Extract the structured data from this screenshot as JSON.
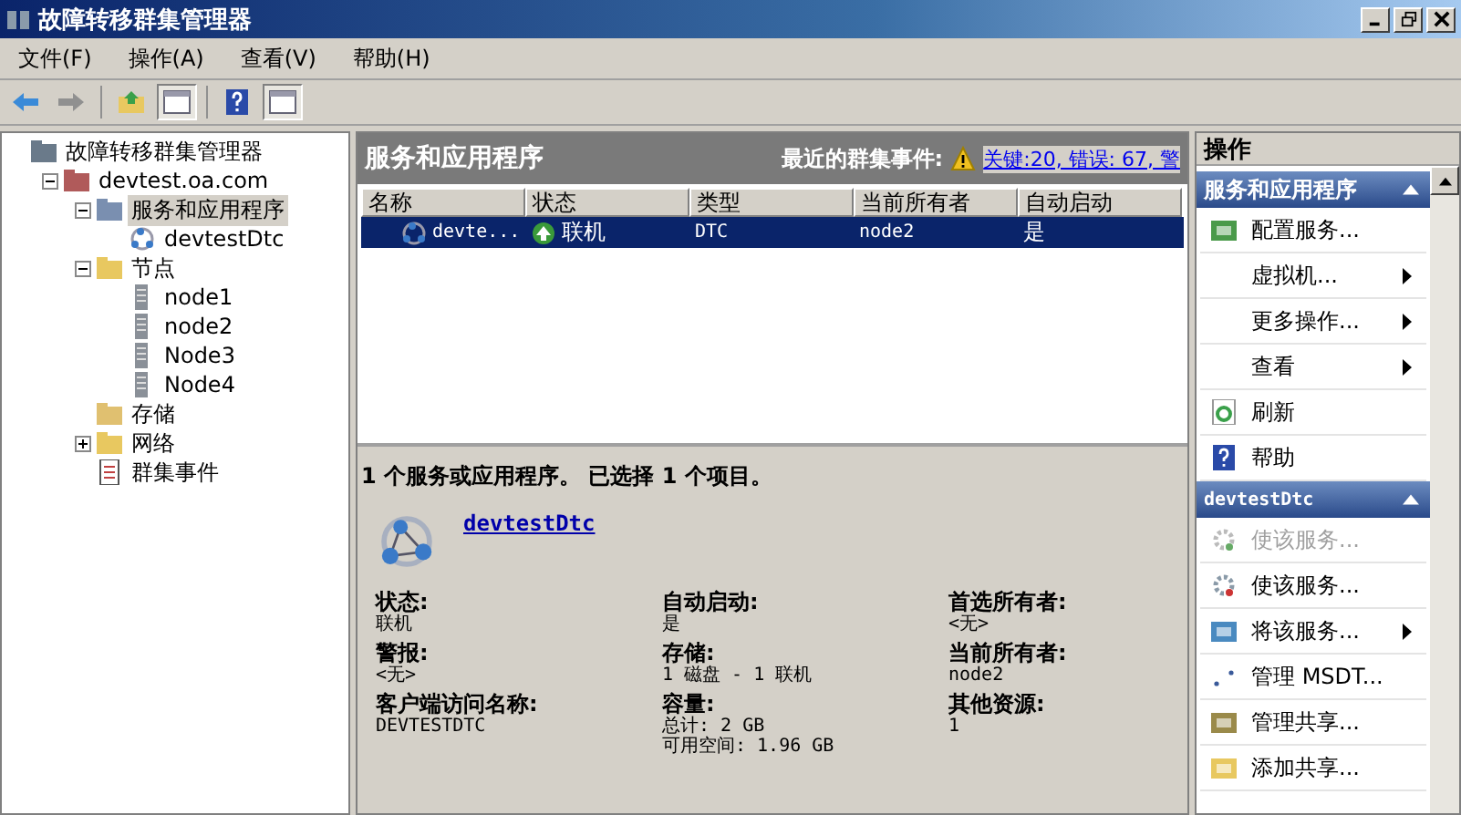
{
  "window": {
    "title": "故障转移群集管理器"
  },
  "menu": [
    "文件(F)",
    "操作(A)",
    "查看(V)",
    "帮助(H)"
  ],
  "tree": [
    {
      "label": "故障转移群集管理器",
      "kind": "manager",
      "selected": false,
      "children": [
        {
          "label": "devtest.oa.com",
          "kind": "cluster",
          "selected": false,
          "expanded": true,
          "children": [
            {
              "label": "服务和应用程序",
              "kind": "services",
              "selected": true,
              "expanded": true,
              "children": [
                {
                  "label": "devtestDtc",
                  "kind": "app",
                  "selected": false
                }
              ]
            },
            {
              "label": "节点",
              "kind": "folder",
              "selected": false,
              "expanded": true,
              "children": [
                {
                  "label": "node1",
                  "kind": "server",
                  "selected": false
                },
                {
                  "label": "node2",
                  "kind": "server",
                  "selected": false
                },
                {
                  "label": "Node3",
                  "kind": "server",
                  "selected": false
                },
                {
                  "label": "Node4",
                  "kind": "server",
                  "selected": false
                }
              ]
            },
            {
              "label": "存储",
              "kind": "storage",
              "selected": false
            },
            {
              "label": "网络",
              "kind": "folder",
              "selected": false,
              "expanded": false
            },
            {
              "label": "群集事件",
              "kind": "events",
              "selected": false
            }
          ]
        }
      ]
    }
  ],
  "center": {
    "title": "服务和应用程序",
    "events_label": "最近的群集事件:",
    "events_link": "关键:20, 错误: 67, 警"
  },
  "table": {
    "columns": [
      "名称",
      "状态",
      "类型",
      "当前所有者",
      "自动启动"
    ],
    "rows": [
      {
        "cells": [
          "devte...",
          "联机",
          "DTC",
          "node2",
          "是"
        ],
        "selected": true
      }
    ]
  },
  "summary": "1 个服务或应用程序。 已选择 1 个项目。",
  "detail": {
    "name": "devtestDtc",
    "fields": [
      {
        "label": "状态:",
        "values": [
          "联机"
        ]
      },
      {
        "label": "自动启动:",
        "values": [
          "是"
        ]
      },
      {
        "label": "首选所有者:",
        "values": [
          "<无>"
        ]
      },
      {
        "label": "警报:",
        "values": [
          "<无>"
        ]
      },
      {
        "label": "存储:",
        "values": [
          "1 磁盘 - 1 联机"
        ]
      },
      {
        "label": "当前所有者:",
        "values": [
          "node2"
        ]
      },
      {
        "label": "客户端访问名称:",
        "values": [
          "DEVTESTDTC"
        ]
      },
      {
        "label": "容量:",
        "values": [
          "总计: 2 GB",
          "可用空间: 1.96 GB"
        ]
      },
      {
        "label": "其他资源:",
        "values": [
          "1"
        ]
      }
    ]
  },
  "actions": {
    "title": "操作",
    "sections": [
      {
        "title": "服务和应用程序",
        "items": [
          {
            "label": "配置服务...",
            "kind": "configure",
            "disabled": false,
            "submenu": false
          },
          {
            "label": "虚拟机...",
            "kind": "none",
            "disabled": false,
            "submenu": true
          },
          {
            "label": "更多操作...",
            "kind": "none",
            "disabled": false,
            "submenu": true
          },
          {
            "label": "查看",
            "kind": "none",
            "disabled": false,
            "submenu": true
          },
          {
            "label": "刷新",
            "kind": "refresh",
            "disabled": false,
            "submenu": false
          },
          {
            "label": "帮助",
            "kind": "help",
            "disabled": false,
            "submenu": false
          }
        ]
      },
      {
        "title": "devtestDtc",
        "items": [
          {
            "label": "使该服务...",
            "kind": "gear",
            "disabled": true,
            "submenu": false
          },
          {
            "label": "使该服务...",
            "kind": "gear",
            "disabled": false,
            "submenu": false
          },
          {
            "label": "将该服务...",
            "kind": "move",
            "disabled": false,
            "submenu": true
          },
          {
            "label": "管理 MSDT...",
            "kind": "dots",
            "disabled": false,
            "submenu": false
          },
          {
            "label": "管理共享...",
            "kind": "share",
            "disabled": false,
            "submenu": false
          },
          {
            "label": "添加共享...",
            "kind": "folder",
            "disabled": false,
            "submenu": false
          }
        ]
      }
    ]
  }
}
